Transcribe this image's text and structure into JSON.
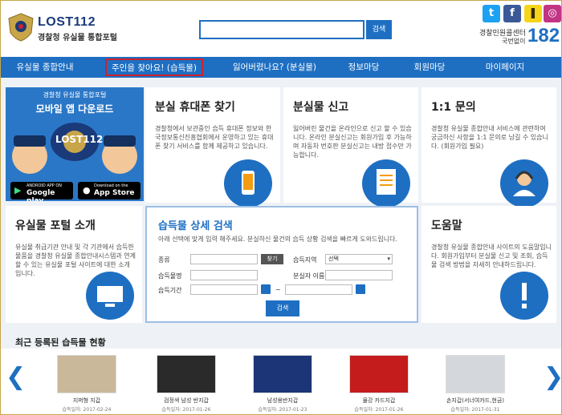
{
  "header": {
    "logo_title": "LOST112",
    "logo_sub": "경찰청 유실물 통합포털",
    "search_button": "검색",
    "callcenter_label": "경찰민원콜센터",
    "callcenter_sub": "국번없이",
    "callcenter_number": "182",
    "sns": [
      "twitter-icon",
      "facebook-icon",
      "kakaostory-icon",
      "instagram-icon"
    ]
  },
  "nav": {
    "items": [
      "유실물 종합안내",
      "주인을 찾아요! (습득물)",
      "잃어버렸나요? (분실물)",
      "정보마당",
      "회원마당",
      "마이페이지"
    ]
  },
  "banner": {
    "line1": "경찰청 유실물 통합포털",
    "line2": "모바일 앱 다운로드",
    "line3": "LOST112",
    "android_small": "ANDROID APP ON",
    "android_big": "Google play",
    "ios_small": "Download on the",
    "ios_big": "App Store"
  },
  "tiles": {
    "phone_title": "분실 휴대폰 찾기",
    "phone_desc": "경찰청에서 보관중인 습득 휴대폰 정보와 한국정보통신진흥협회에서 운영하고 있는 휴대폰 찾기 서비스를 함께 제공하고 있습니다.",
    "report_title": "분실물 신고",
    "report_desc": "잃어버린 물건을 온라인으로 신고 할 수 있습니다. 온라인 분실신고는 회원가입 후 가능하며 자동차 번호판 분실신고는 내방 접수만 가능합니다.",
    "inquiry_title": "1:1 문의",
    "inquiry_desc": "경찰청 유실물 종합안내 서비스에 관련하여 궁금하신 사항을 1:1 문의로 남길 수 있습니다. (회원가입 필요)",
    "intro_title": "유실물 포털 소개",
    "intro_desc": "유실물 취급기관 안내 및 각 기관에서 습득한 물품을 경찰청 유실물 종합안내시스템과 연계할 수 있는 유실물 포털 사이트에 대한 소개입니다.",
    "help_title": "도움말",
    "help_desc": "경찰청 유실물 종합안내 사이트의 도움말입니다. 회원가입부터 분실물 신고 및 조회, 습득물 검색 방법을 자세히 안내하드립니다."
  },
  "detail_search": {
    "title": "습득물 상세 검색",
    "desc": "아래 선택에 맞게 입력 해주세요. 분실하신 물건의 습득 상황 검색을 빠르게 도와드립니다.",
    "kind_label": "종류",
    "find_button": "찾기",
    "area_label": "습득지역",
    "area_value": "선택",
    "item_label": "습득물명",
    "place_label": "분실자 이름",
    "period_label": "습득기간",
    "range_sep": "~",
    "search_button": "검색"
  },
  "recent": {
    "title": "최근 등록된 습득물 현황",
    "items": [
      {
        "name": "지퍼형 지갑",
        "date": "습득일자: 2017-02-24",
        "color": "#c9b89a"
      },
      {
        "name": "검정색 남성 반지갑",
        "date": "습득일자: 2017-01-26",
        "color": "#2a2a2a"
      },
      {
        "name": "남성용반지갑",
        "date": "습득일자: 2017-01-23",
        "color": "#1c3577"
      },
      {
        "name": "물강 카드지갑",
        "date": "습득일자: 2017-01-26",
        "color": "#c41c1c"
      },
      {
        "name": "손지갑(서너여카드,현금)",
        "date": "습득일자: 2017-01-31",
        "color": "#d4d7dc"
      }
    ]
  },
  "colors": {
    "accent": "#1e6fc2",
    "highlight": "#d0212a"
  }
}
